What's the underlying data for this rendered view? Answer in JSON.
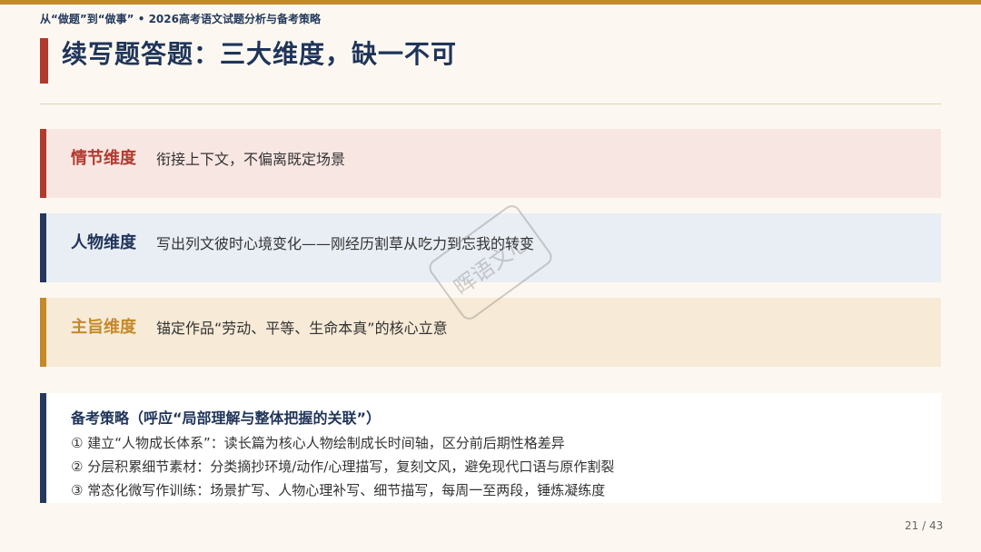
{
  "header": {
    "note": "从“做题”到“做事” • 2026高考语文试题分析与备考策略"
  },
  "slide": {
    "title": "续写题答题：三大维度，缺一不可"
  },
  "dimensions": [
    {
      "label": "情节维度",
      "text": "衔接上下文，不偏离既定场景"
    },
    {
      "label": "人物维度",
      "text": "写出列文彼时心境变化——刚经历割草从吃力到忘我的转变"
    },
    {
      "label": "主旨维度",
      "text": "锚定作品“劳动、平等、生命本真”的核心立意"
    }
  ],
  "strategy": {
    "title": "备考策略（呼应“局部理解与整体把握的关联”）",
    "items": [
      "① 建立“人物成长体系”：读长篇为核心人物绘制成长时间轴，区分前后期性格差异",
      "② 分层积累细节素材：分类摘抄环境/动作/心理描写，复刻文风，避免现代口语与原作割裂",
      "③ 常态化微写作训练：场景扩写、人物心理补写、细节描写，每周一至两段，锤炼凝练度"
    ]
  },
  "watermark": "晖语文心",
  "page": "21 / 43",
  "colors": {
    "accent_gold": "#c48a2a",
    "accent_red": "#b13a2e",
    "navy": "#1f3459"
  }
}
